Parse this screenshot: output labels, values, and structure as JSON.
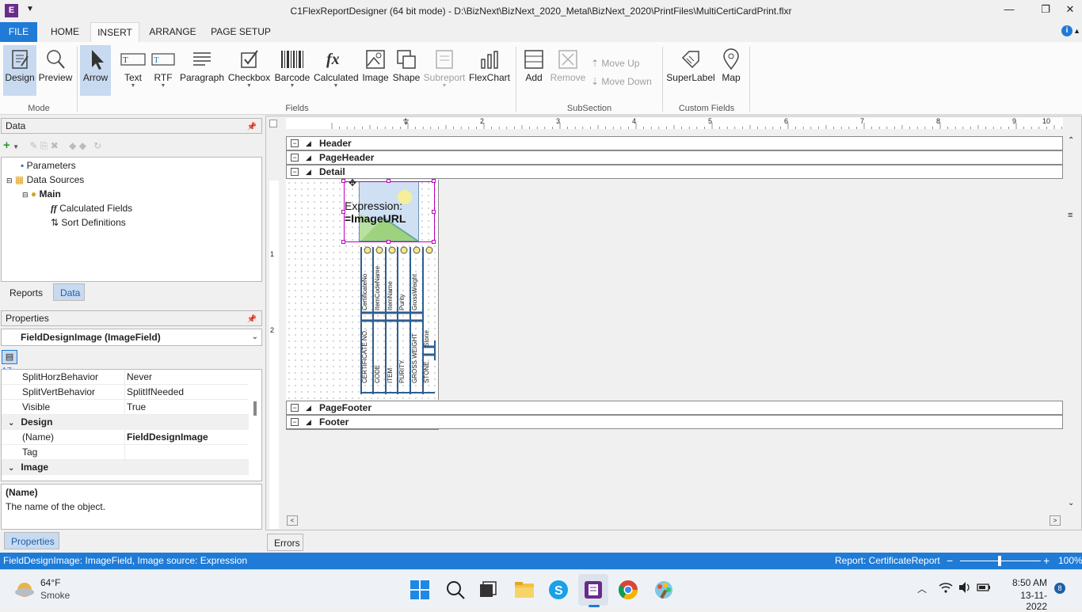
{
  "window": {
    "title": "C1FlexReportDesigner (64 bit mode) - D:\\BizNext\\BizNext_2020_Metal\\BizNext_2020\\PrintFiles\\MultiCertiCardPrint.flxr"
  },
  "ribbon_tabs": [
    "FILE",
    "HOME",
    "INSERT",
    "ARRANGE",
    "PAGE SETUP"
  ],
  "ribbon": {
    "mode": {
      "label": "Mode",
      "design": "Design",
      "preview": "Preview"
    },
    "fields": {
      "label": "Fields",
      "arrow": "Arrow",
      "text": "Text",
      "rtf": "RTF",
      "paragraph": "Paragraph",
      "checkbox": "Checkbox",
      "barcode": "Barcode",
      "calculated": "Calculated",
      "image": "Image",
      "shape": "Shape",
      "subreport": "Subreport",
      "flexchart": "FlexChart"
    },
    "subsection": {
      "label": "SubSection",
      "add": "Add",
      "remove": "Remove",
      "move_up": "Move Up",
      "move_down": "Move Down"
    },
    "custom": {
      "label": "Custom Fields",
      "superlabel": "SuperLabel",
      "map": "Map"
    }
  },
  "data_panel": {
    "title": "Data",
    "tree": {
      "parameters": "Parameters",
      "data_sources": "Data Sources",
      "main": "Main",
      "calculated_fields": "Calculated Fields",
      "sort_definitions": "Sort Definitions"
    },
    "tabs": {
      "reports": "Reports",
      "data": "Data"
    }
  },
  "properties_panel": {
    "title": "Properties",
    "selected_object": "FieldDesignImage (ImageField)",
    "rows": [
      {
        "name": "SplitHorzBehavior",
        "value": "Never"
      },
      {
        "name": "SplitVertBehavior",
        "value": "SplitIfNeeded"
      },
      {
        "name": "Visible",
        "value": "True"
      }
    ],
    "cat_design": "Design",
    "design_rows": [
      {
        "name": "(Name)",
        "value": "FieldDesignImage"
      },
      {
        "name": "Tag",
        "value": ""
      }
    ],
    "cat_image": "Image",
    "help_title": "(Name)",
    "help_text": "The name of the object.",
    "tab": "Properties"
  },
  "designer": {
    "ruler_marks": [
      "1",
      "2",
      "3",
      "4",
      "5",
      "6",
      "7",
      "8",
      "9",
      "10"
    ],
    "vruler_marks": [
      "1",
      "2"
    ],
    "sections": {
      "header": "Header",
      "pageheader": "PageHeader",
      "detail": "Detail",
      "pagefooter": "PageFooter",
      "footer": "Footer"
    },
    "image_field": {
      "line1": "Expression:",
      "line2": "=ImageURL"
    },
    "columns_top": [
      "CertificateNo",
      "ItemCodeName",
      "ItemName",
      "Purity",
      "GrossWeight"
    ],
    "columns_bottom": [
      "CERTIFICATE NO.",
      "CODE",
      "ITEM",
      "PURITY",
      "GROSS WEIGHT",
      "STONE"
    ],
    "stone_label": "Stone"
  },
  "errors_tab": "Errors",
  "status": {
    "left": "FieldDesignImage: ImageField, Image source: Expression",
    "report": "Report: CertificateReport",
    "zoom": "100%",
    "zoom_level": 0.5
  },
  "taskbar": {
    "temp": "64°F",
    "weather": "Smoke",
    "time": "8:50 AM",
    "date": "13-11-2022",
    "badge": "8"
  },
  "colors": {
    "accent": "#1f7bd6",
    "selection": "#c8daf0",
    "field_selection": "#c000c0"
  }
}
